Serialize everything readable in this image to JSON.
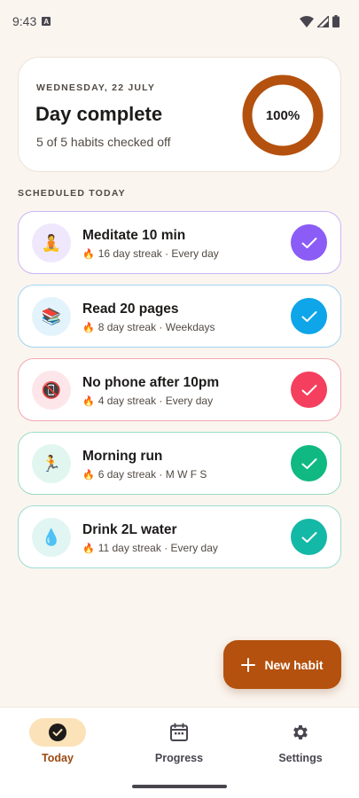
{
  "status_bar": {
    "time": "9:43",
    "notification_icon": "a-icon",
    "icons": [
      "wifi-icon",
      "signal-icon",
      "battery-icon"
    ]
  },
  "summary": {
    "date": "WEDNESDAY, 22 JULY",
    "title": "Day complete",
    "subtitle": "5 of 5 habits checked off",
    "progress_percent": 100,
    "progress_label": "100%",
    "ring_color": "#b4510e"
  },
  "section_label": "SCHEDULED TODAY",
  "habits": [
    {
      "name": "Meditate 10 min",
      "streak": "16 day streak · Every day",
      "emoji": "🧘",
      "accent": "#8b5cf6",
      "border": "#c9b6f7",
      "tint": "#efe8fd",
      "checked": true
    },
    {
      "name": "Read 20 pages",
      "streak": "8 day streak · Weekdays",
      "emoji": "📚",
      "accent": "#0ea5e9",
      "border": "#9fd4f1",
      "tint": "#e3f3fc",
      "checked": true
    },
    {
      "name": "No phone after 10pm",
      "streak": "4 day streak · Every day",
      "emoji": "📵",
      "accent": "#f43f5e",
      "border": "#f3a8b4",
      "tint": "#fde6ea",
      "checked": true
    },
    {
      "name": "Morning run",
      "streak": "6 day streak · M W F S",
      "emoji": "🏃",
      "accent": "#10b981",
      "border": "#98dcc3",
      "tint": "#e1f6ee",
      "checked": true
    },
    {
      "name": "Drink 2L water",
      "streak": "11 day streak · Every day",
      "emoji": "💧",
      "accent": "#14b8a6",
      "border": "#9ddcd3",
      "tint": "#e1f5f2",
      "checked": true
    }
  ],
  "flame_icon": "🔥",
  "fab": {
    "label": "New habit",
    "icon": "plus-icon"
  },
  "nav": [
    {
      "label": "Today",
      "icon": "check-circle-icon",
      "active": true
    },
    {
      "label": "Progress",
      "icon": "calendar-icon",
      "active": false
    },
    {
      "label": "Settings",
      "icon": "gear-icon",
      "active": false
    }
  ]
}
